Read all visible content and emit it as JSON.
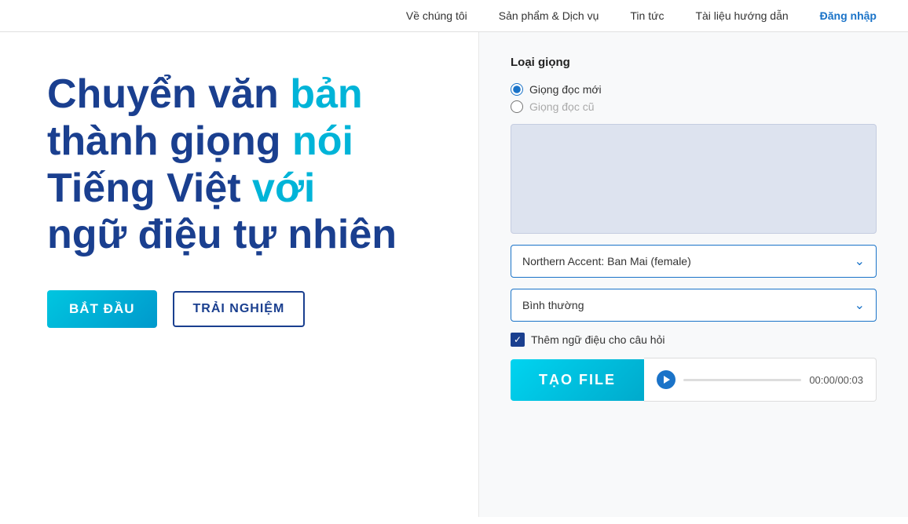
{
  "nav": {
    "items": [
      {
        "id": "about",
        "label": "Về chúng tôi"
      },
      {
        "id": "products",
        "label": "Sản phẩm & Dịch vụ"
      },
      {
        "id": "news",
        "label": "Tin tức"
      },
      {
        "id": "docs",
        "label": "Tài liệu hướng dẫn"
      },
      {
        "id": "login",
        "label": "Đăng nhập"
      }
    ]
  },
  "hero": {
    "line1": "Chuyển văn ",
    "line1_highlight": "bản",
    "line2_start": "thành giọng ",
    "line2_highlight": "nói",
    "line3_start": "Tiếng Việt ",
    "line3_highlight": "với",
    "line4": "ngữ điệu tự nhiên",
    "btn_start": "BẮT ĐẦU",
    "btn_trial": "TRẢI NGHIỆM"
  },
  "right_panel": {
    "loai_giong_label": "Loại giọng",
    "radio_new": "Giọng đọc mới",
    "radio_old": "Giọng đọc cũ",
    "voice_select_value": "Northern Accent: Ban Mai (female)",
    "speed_select_value": "Bình thường",
    "checkbox_label": "Thêm ngữ điệu cho câu hỏi",
    "btn_tao_file": "TẠO FILE",
    "time_display": "00:00/00:03"
  }
}
